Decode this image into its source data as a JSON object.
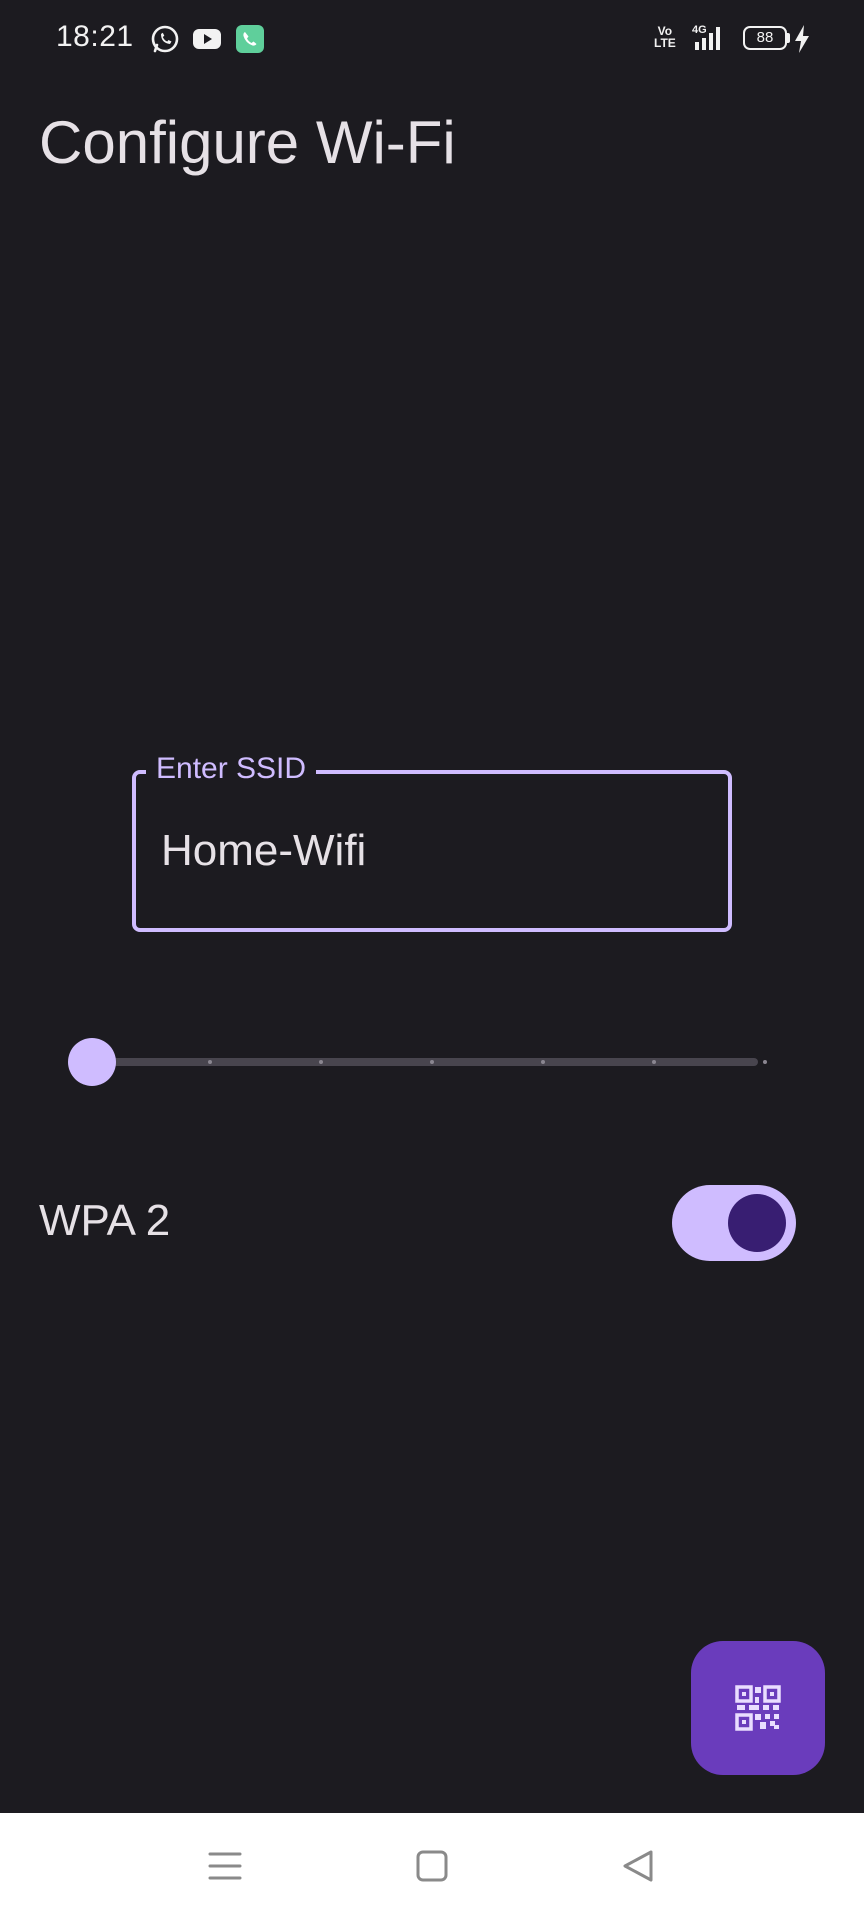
{
  "status_bar": {
    "time": "18:21",
    "icons": [
      "whatsapp-icon",
      "youtube-icon",
      "phone-call-icon",
      "volte-icon",
      "4g-signal-icon",
      "battery-icon",
      "charging-bolt-icon"
    ],
    "volte_text": "Vo\nLTE",
    "battery_level": "88"
  },
  "header": {
    "title": "Configure Wi-Fi"
  },
  "ssid_field": {
    "label": "Enter SSID",
    "value": "Home-Wifi",
    "accent_color": "#cfbcff"
  },
  "slider": {
    "steps": 6,
    "value": 0
  },
  "wpa_toggle": {
    "label": "WPA 2",
    "checked": true
  },
  "fab": {
    "icon": "qr-code-icon",
    "color": "#6a3cbc"
  },
  "nav_bar": {
    "icons": [
      "menu-icon",
      "home-square-icon",
      "back-triangle-icon"
    ]
  },
  "colors": {
    "background": "#1c1b20",
    "primary": "#cfbcff",
    "on_primary": "#381e72"
  }
}
